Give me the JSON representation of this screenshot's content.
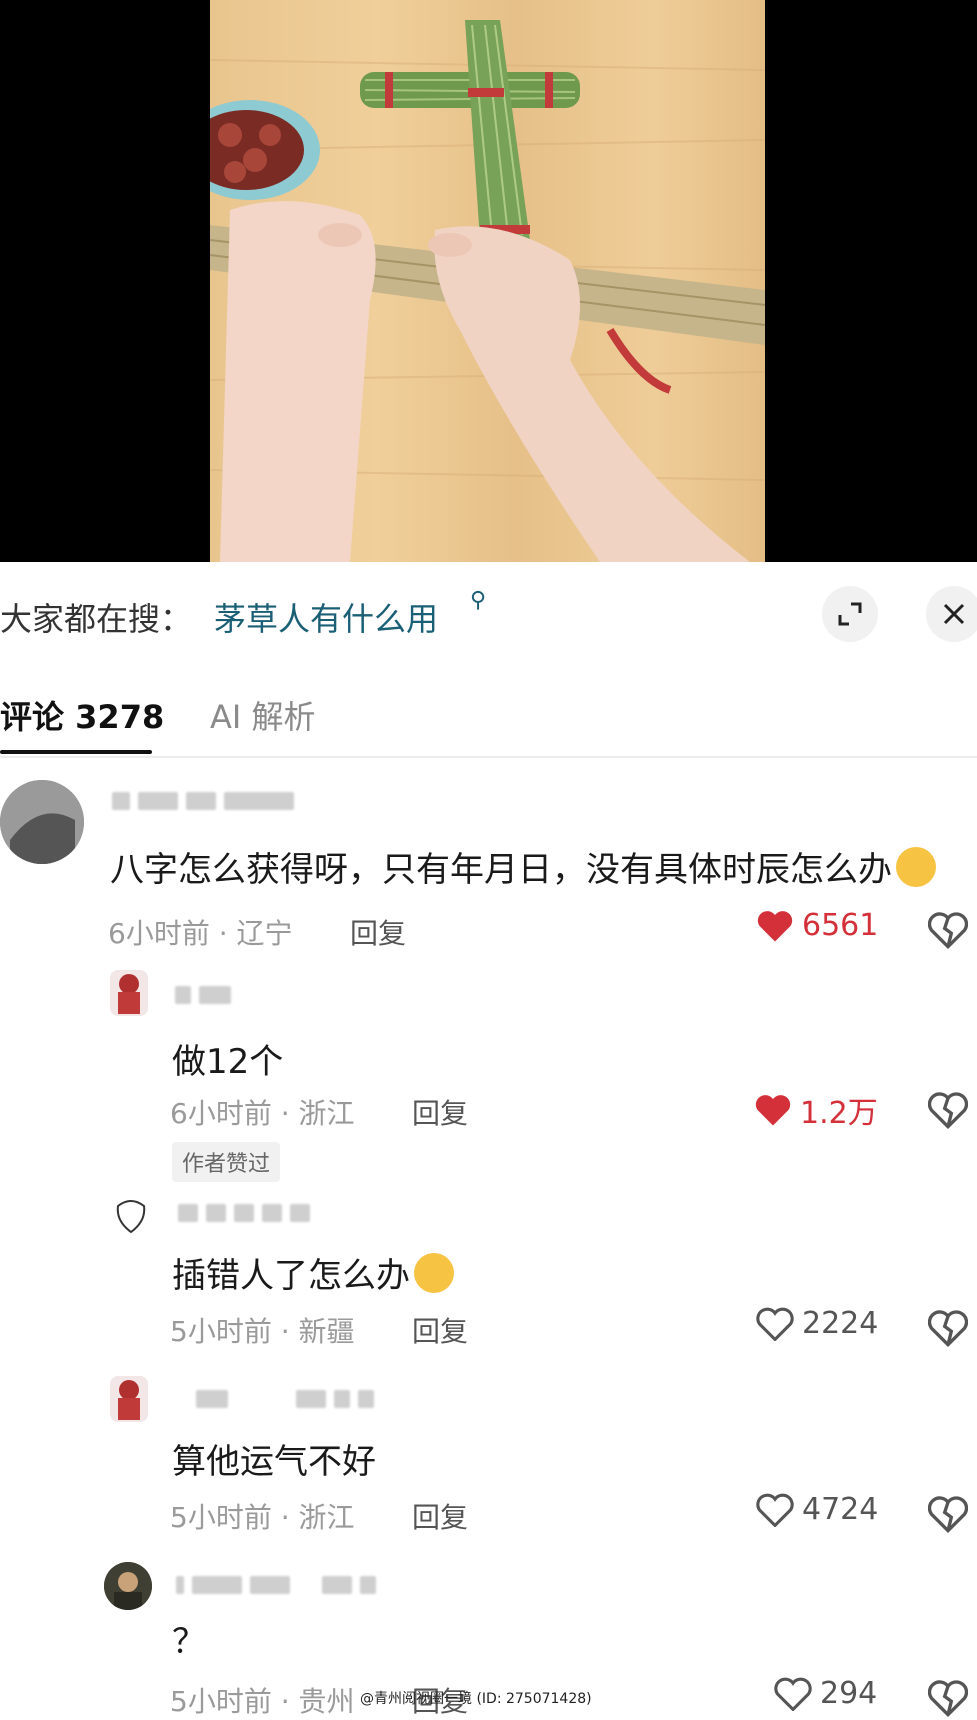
{
  "search": {
    "prefix": "大家都在搜：",
    "query": "茅草人有什么用",
    "search_icon": "search-icon",
    "expand_icon": "expand-icon",
    "close_icon": "close-icon"
  },
  "tabs": {
    "comments_label": "评论",
    "comments_count": "3278",
    "ai_label": "AI 解析"
  },
  "comments": [
    {
      "text": "八字怎么获得呀，只有年月日，没有具体时辰怎么办",
      "emoji": "pleading-face-emoji",
      "time": "6小时前",
      "location": "辽宁",
      "reply": "回复",
      "likes": "6561",
      "liked": true
    },
    {
      "text": "做12个",
      "time": "6小时前",
      "location": "浙江",
      "reply": "回复",
      "likes": "1.2万",
      "liked": true,
      "badge": "作者赞过"
    },
    {
      "text": "插错人了怎么办",
      "emoji": "rolling-laughing-emoji",
      "time": "5小时前",
      "location": "新疆",
      "reply": "回复",
      "likes": "2224",
      "liked": false
    },
    {
      "text": "算他运气不好",
      "time": "5小时前",
      "location": "浙江",
      "reply": "回复",
      "likes": "4724",
      "liked": false
    },
    {
      "text": "？",
      "time": "5小时前",
      "location": "贵州",
      "reply": "回复",
      "likes": "294",
      "liked": false
    }
  ],
  "watermark": "@青州阅视圈一境 (ID: 275071428)",
  "colors": {
    "like_red": "#d3303a",
    "search_link": "#1b5f76"
  }
}
